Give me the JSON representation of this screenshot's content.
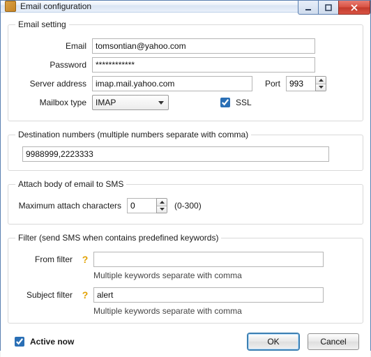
{
  "window": {
    "title": "Email configuration"
  },
  "emailSetting": {
    "legend": "Email setting",
    "emailLabel": "Email",
    "emailValue": "tomsontian@yahoo.com",
    "passwordLabel": "Password",
    "passwordValue": "************",
    "serverLabel": "Server address",
    "serverValue": "imap.mail.yahoo.com",
    "portLabel": "Port",
    "portValue": "993",
    "mailboxLabel": "Mailbox type",
    "mailboxValue": "IMAP",
    "sslLabel": "SSL",
    "sslChecked": true
  },
  "destination": {
    "legend": "Destination numbers (multiple numbers separate with comma)",
    "value": "9988999,2223333"
  },
  "attach": {
    "legend": "Attach body of email to SMS",
    "maxLabel": "Maximum attach characters",
    "maxValue": "0",
    "rangeHint": "(0-300)"
  },
  "filter": {
    "legend": "Filter (send SMS when contains predefined keywords)",
    "fromLabel": "From filter",
    "fromValue": "",
    "subjectLabel": "Subject filter",
    "subjectValue": "alert",
    "hint": "Multiple keywords separate with comma"
  },
  "footer": {
    "activeNowLabel": "Active now",
    "activeNowChecked": true,
    "okLabel": "OK",
    "cancelLabel": "Cancel"
  }
}
